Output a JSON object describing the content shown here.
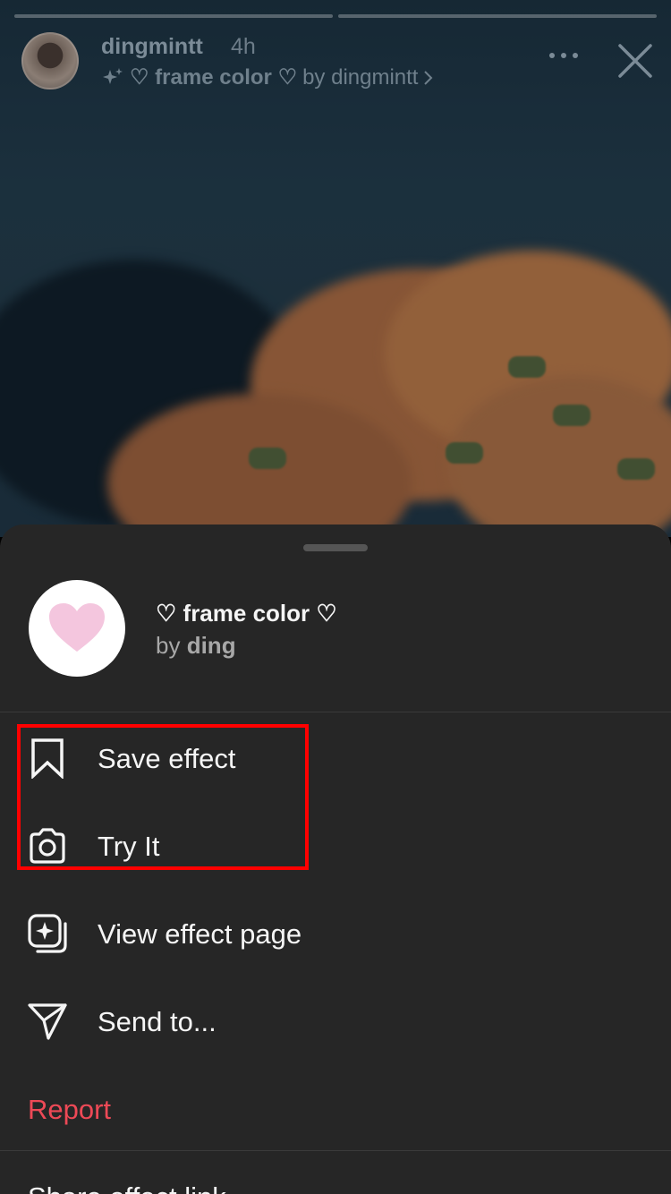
{
  "story": {
    "username": "dingmintt",
    "time_ago": "4h",
    "effect_name": "♡ frame color ♡",
    "effect_by": "by dingmintt",
    "progress_segments": 2
  },
  "sheet": {
    "effect": {
      "title": "♡ frame color ♡",
      "by_prefix": "by",
      "author": "ding"
    },
    "menu": [
      {
        "label": "Save effect",
        "icon": "bookmark-icon"
      },
      {
        "label": "Try It",
        "icon": "camera-icon"
      },
      {
        "label": "View effect page",
        "icon": "effect-page-icon"
      },
      {
        "label": "Send to...",
        "icon": "send-icon"
      }
    ],
    "report_label": "Report",
    "share_label": "Share effect link"
  },
  "colors": {
    "sheet_bg": "#262626",
    "danger": "#ed4956",
    "highlight": "#ff0000",
    "heart_pink": "#f4c6de"
  }
}
